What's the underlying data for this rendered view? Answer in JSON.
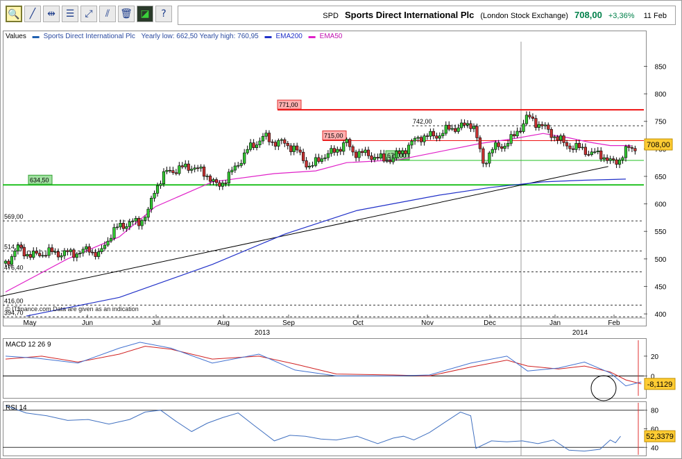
{
  "toolbar": {
    "buttons": [
      {
        "name": "zoom-button",
        "icon": "magnifier-icon",
        "glyph": "🔍",
        "active": true
      },
      {
        "name": "trendline-button",
        "icon": "line-draw-icon",
        "glyph": "╱"
      },
      {
        "name": "horizontal-line-button",
        "icon": "horizontal-line-icon",
        "glyph": "⇹"
      },
      {
        "name": "fibonacci-button",
        "icon": "fibonacci-icon",
        "glyph": "☰"
      },
      {
        "name": "channel-button",
        "icon": "channel-icon",
        "glyph": "⤢"
      },
      {
        "name": "parallel-line-button",
        "icon": "parallel-line-icon",
        "glyph": "⫽"
      },
      {
        "name": "delete-button",
        "icon": "trash-icon",
        "glyph": "🗑"
      },
      {
        "name": "chart-type-button",
        "icon": "chart-icon",
        "glyph": "◪",
        "dark": true
      },
      {
        "name": "help-button",
        "icon": "help-icon",
        "glyph": "?"
      }
    ]
  },
  "header": {
    "ticker": "SPD",
    "name": "Sports Direct International Plc",
    "exchange": "(London Stock Exchange)",
    "price": "708,00",
    "change": "+3,36%",
    "date": "11 Feb"
  },
  "legend": {
    "values_label": "Values",
    "series_name": "Sports Direct International Plc",
    "yearly": "Yearly low: 662,50 Yearly high: 760,95",
    "ema200": "EMA200",
    "ema50": "EMA50"
  },
  "colors": {
    "up": "#33c833",
    "down": "#c83232",
    "ema200": "#2030c8",
    "ema50": "#e020c8",
    "trend": "#000000",
    "resist": "#ee1010",
    "support": "#20c020",
    "macd": "#4070d0",
    "signal": "#d02020",
    "rsi": "#4070c0"
  },
  "chart_data": [
    {
      "type": "candlestick",
      "title": "Sports Direct International Plc",
      "y_ticks": [
        400,
        450,
        500,
        550,
        600,
        650,
        700,
        750,
        800,
        850
      ],
      "ylim": [
        390,
        915
      ],
      "x_tick_labels": [
        "May",
        "Jun",
        "Jul",
        "Aug",
        "Sep",
        "Oct",
        "Nov",
        "Dec",
        "Jan",
        "Feb"
      ],
      "year_labels": [
        "2013",
        "2014"
      ],
      "current_price_label": "708,00",
      "last_close": 708,
      "levels": [
        {
          "value": 771,
          "label": "771,00",
          "style": "resistance"
        },
        {
          "value": 742,
          "label": "742,00",
          "style": "dashed"
        },
        {
          "value": 715,
          "label": "715,00",
          "style": "resistance"
        },
        {
          "value": 679,
          "label": "679,00",
          "style": "support"
        },
        {
          "value": 634.5,
          "label": "634,50",
          "style": "support-strong"
        },
        {
          "value": 569,
          "label": "569,00",
          "style": "dashed"
        },
        {
          "value": 514.5,
          "label": "514,50",
          "style": "dashed"
        },
        {
          "value": 476.4,
          "label": "476,40",
          "style": "dashed"
        },
        {
          "value": 416,
          "label": "416,00",
          "style": "dashed"
        },
        {
          "value": 394.7,
          "label": "394,70",
          "style": "dashed"
        }
      ],
      "watermark": "© ITfinance.com Data are given as an indication",
      "close_path": [
        [
          0,
          492
        ],
        [
          12,
          520
        ],
        [
          25,
          505
        ],
        [
          40,
          512
        ],
        [
          55,
          510
        ],
        [
          75,
          512
        ],
        [
          80,
          520
        ],
        [
          90,
          505
        ],
        [
          100,
          540
        ],
        [
          110,
          560
        ],
        [
          120,
          565
        ],
        [
          130,
          568
        ],
        [
          138,
          585
        ],
        [
          145,
          630
        ],
        [
          155,
          657
        ],
        [
          170,
          665
        ],
        [
          180,
          668
        ],
        [
          195,
          653
        ],
        [
          205,
          630
        ],
        [
          220,
          660
        ],
        [
          235,
          700
        ],
        [
          250,
          722
        ],
        [
          260,
          712
        ],
        [
          270,
          710
        ],
        [
          280,
          700
        ],
        [
          295,
          665
        ],
        [
          305,
          685
        ],
        [
          315,
          692
        ],
        [
          330,
          712
        ],
        [
          335,
          695
        ],
        [
          350,
          690
        ],
        [
          365,
          680
        ],
        [
          375,
          683
        ],
        [
          390,
          705
        ],
        [
          400,
          722
        ],
        [
          410,
          723
        ],
        [
          420,
          726
        ],
        [
          430,
          738
        ],
        [
          440,
          739
        ],
        [
          452,
          748
        ],
        [
          462,
          672
        ],
        [
          470,
          700
        ],
        [
          480,
          705
        ],
        [
          490,
          718
        ],
        [
          505,
          758
        ],
        [
          520,
          740
        ],
        [
          530,
          725
        ],
        [
          540,
          710
        ],
        [
          550,
          702
        ],
        [
          560,
          700
        ],
        [
          565,
          690
        ],
        [
          575,
          692
        ],
        [
          585,
          675
        ],
        [
          592,
          678
        ],
        [
          602,
          700
        ],
        [
          610,
          702
        ]
      ],
      "ema50_path": [
        [
          0,
          440
        ],
        [
          60,
          500
        ],
        [
          110,
          540
        ],
        [
          145,
          595
        ],
        [
          200,
          640
        ],
        [
          260,
          655
        ],
        [
          300,
          660
        ],
        [
          330,
          675
        ],
        [
          380,
          680
        ],
        [
          420,
          695
        ],
        [
          460,
          710
        ],
        [
          490,
          718
        ],
        [
          520,
          728
        ],
        [
          545,
          720
        ],
        [
          565,
          712
        ],
        [
          585,
          706
        ],
        [
          605,
          706
        ]
      ],
      "ema200_path": [
        [
          20,
          396
        ],
        [
          110,
          430
        ],
        [
          200,
          490
        ],
        [
          270,
          545
        ],
        [
          340,
          588
        ],
        [
          420,
          616
        ],
        [
          470,
          630
        ],
        [
          520,
          640
        ],
        [
          560,
          643
        ],
        [
          600,
          645
        ]
      ],
      "trendline": [
        [
          -5,
          432
        ],
        [
          583,
          668
        ]
      ],
      "macd": {
        "y_ticks": [
          0,
          20
        ],
        "ylim": [
          -20,
          36
        ],
        "current_label": "-8,1129",
        "macd_path": [
          [
            0,
            20
          ],
          [
            30,
            18
          ],
          [
            70,
            13
          ],
          [
            110,
            28
          ],
          [
            130,
            34
          ],
          [
            160,
            28
          ],
          [
            200,
            13
          ],
          [
            245,
            22
          ],
          [
            280,
            6
          ],
          [
            320,
            0
          ],
          [
            375,
            0
          ],
          [
            410,
            1
          ],
          [
            450,
            13
          ],
          [
            485,
            20
          ],
          [
            505,
            5
          ],
          [
            535,
            8
          ],
          [
            560,
            14
          ],
          [
            585,
            3
          ],
          [
            600,
            -10
          ],
          [
            615,
            -6
          ]
        ],
        "signal_path": [
          [
            0,
            17
          ],
          [
            35,
            20
          ],
          [
            70,
            14
          ],
          [
            110,
            22
          ],
          [
            135,
            30
          ],
          [
            160,
            27
          ],
          [
            200,
            17
          ],
          [
            245,
            20
          ],
          [
            280,
            12
          ],
          [
            320,
            2
          ],
          [
            375,
            1
          ],
          [
            410,
            0
          ],
          [
            450,
            9
          ],
          [
            485,
            16
          ],
          [
            505,
            10
          ],
          [
            535,
            7
          ],
          [
            560,
            10
          ],
          [
            585,
            4
          ],
          [
            600,
            -4
          ],
          [
            615,
            -8
          ]
        ]
      },
      "rsi": {
        "y_ticks": [
          40,
          60,
          80
        ],
        "ylim": [
          32,
          88
        ],
        "label": "RSI 14",
        "current_label": "52,3379",
        "rsi_path": [
          [
            0,
            85
          ],
          [
            20,
            77
          ],
          [
            40,
            74
          ],
          [
            60,
            69
          ],
          [
            80,
            70
          ],
          [
            100,
            65
          ],
          [
            120,
            70
          ],
          [
            135,
            78
          ],
          [
            150,
            80
          ],
          [
            165,
            68
          ],
          [
            180,
            57
          ],
          [
            195,
            66
          ],
          [
            210,
            72
          ],
          [
            225,
            77
          ],
          [
            240,
            64
          ],
          [
            260,
            47
          ],
          [
            275,
            53
          ],
          [
            290,
            52
          ],
          [
            305,
            49
          ],
          [
            320,
            48
          ],
          [
            340,
            52
          ],
          [
            360,
            44
          ],
          [
            375,
            50
          ],
          [
            385,
            52
          ],
          [
            395,
            48
          ],
          [
            410,
            56
          ],
          [
            425,
            67
          ],
          [
            440,
            78
          ],
          [
            450,
            74
          ],
          [
            455,
            39
          ],
          [
            470,
            47
          ],
          [
            485,
            46
          ],
          [
            500,
            47
          ],
          [
            515,
            44
          ],
          [
            530,
            48
          ],
          [
            545,
            37
          ],
          [
            560,
            36
          ],
          [
            575,
            38
          ],
          [
            585,
            48
          ],
          [
            590,
            45
          ],
          [
            595,
            52
          ]
        ]
      },
      "annotation": "circle-around-macd-crossover"
    }
  ]
}
